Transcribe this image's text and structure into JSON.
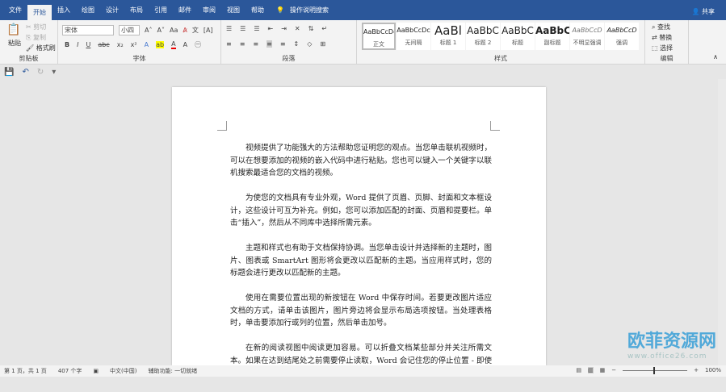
{
  "tabs": [
    "文件",
    "开始",
    "插入",
    "绘图",
    "设计",
    "布局",
    "引用",
    "邮件",
    "审阅",
    "视图",
    "帮助"
  ],
  "tell_me": "操作说明搜索",
  "share": "共享",
  "clipboard": {
    "paste": "粘贴",
    "cut": "剪切",
    "copy": "复制",
    "format_painter": "格式刷",
    "label": "剪贴板"
  },
  "font": {
    "name": "宋体",
    "size": "小四",
    "label": "字体"
  },
  "paragraph": {
    "label": "段落"
  },
  "styles": {
    "items": [
      {
        "sample": "AaBbCcDc",
        "label": "正文"
      },
      {
        "sample": "AaBbCcDc",
        "label": "无间隔"
      },
      {
        "sample": "AaBl",
        "label": "标题 1"
      },
      {
        "sample": "AaBbC",
        "label": "标题 2"
      },
      {
        "sample": "AaBbC",
        "label": "标题"
      },
      {
        "sample": "AaBbC",
        "label": "副标题"
      },
      {
        "sample": "AaBbCcD",
        "label": "不明显强调"
      },
      {
        "sample": "AaBbCcD",
        "label": "强调"
      }
    ],
    "label": "样式"
  },
  "editing": {
    "find": "查找",
    "replace": "替换",
    "select": "选择",
    "label": "编辑"
  },
  "document": {
    "paragraphs": [
      "视频提供了功能强大的方法帮助您证明您的观点。当您单击联机视频时，可以在想要添加的视频的嵌入代码中进行粘贴。您也可以键入一个关键字以联机搜索最适合您的文档的视频。",
      "为使您的文档具有专业外观，Word 提供了页眉、页脚、封面和文本框设计，这些设计可互为补充。例如，您可以添加匹配的封面、页眉和提要栏。单击“插入”，然后从不同库中选择所需元素。",
      "主题和样式也有助于文档保持协调。当您单击设计并选择新的主题时，图片、图表或 SmartArt 图形将会更改以匹配新的主题。当应用样式时，您的标题会进行更改以匹配新的主题。",
      "使用在需要位置出现的新按钮在 Word 中保存时间。若要更改图片适应文档的方式，请单击该图片，图片旁边将会显示布局选项按钮。当处理表格时，单击要添加行或列的位置，然后单击加号。",
      "在新的阅读视图中阅读更加容易。可以折叠文档某些部分并关注所需文本。如果在达到结尾处之前需要停止读取，Word 会记住您的停止位置 - 即使在另一个设备上。"
    ]
  },
  "status": {
    "page": "第 1 页，共 1 页",
    "words": "407 个字",
    "language": "中文(中国)",
    "accessibility": "辅助功能: 一切就绪",
    "zoom": "100%"
  },
  "watermark": {
    "name": "欧菲资源网",
    "url": "www.office26.com"
  }
}
